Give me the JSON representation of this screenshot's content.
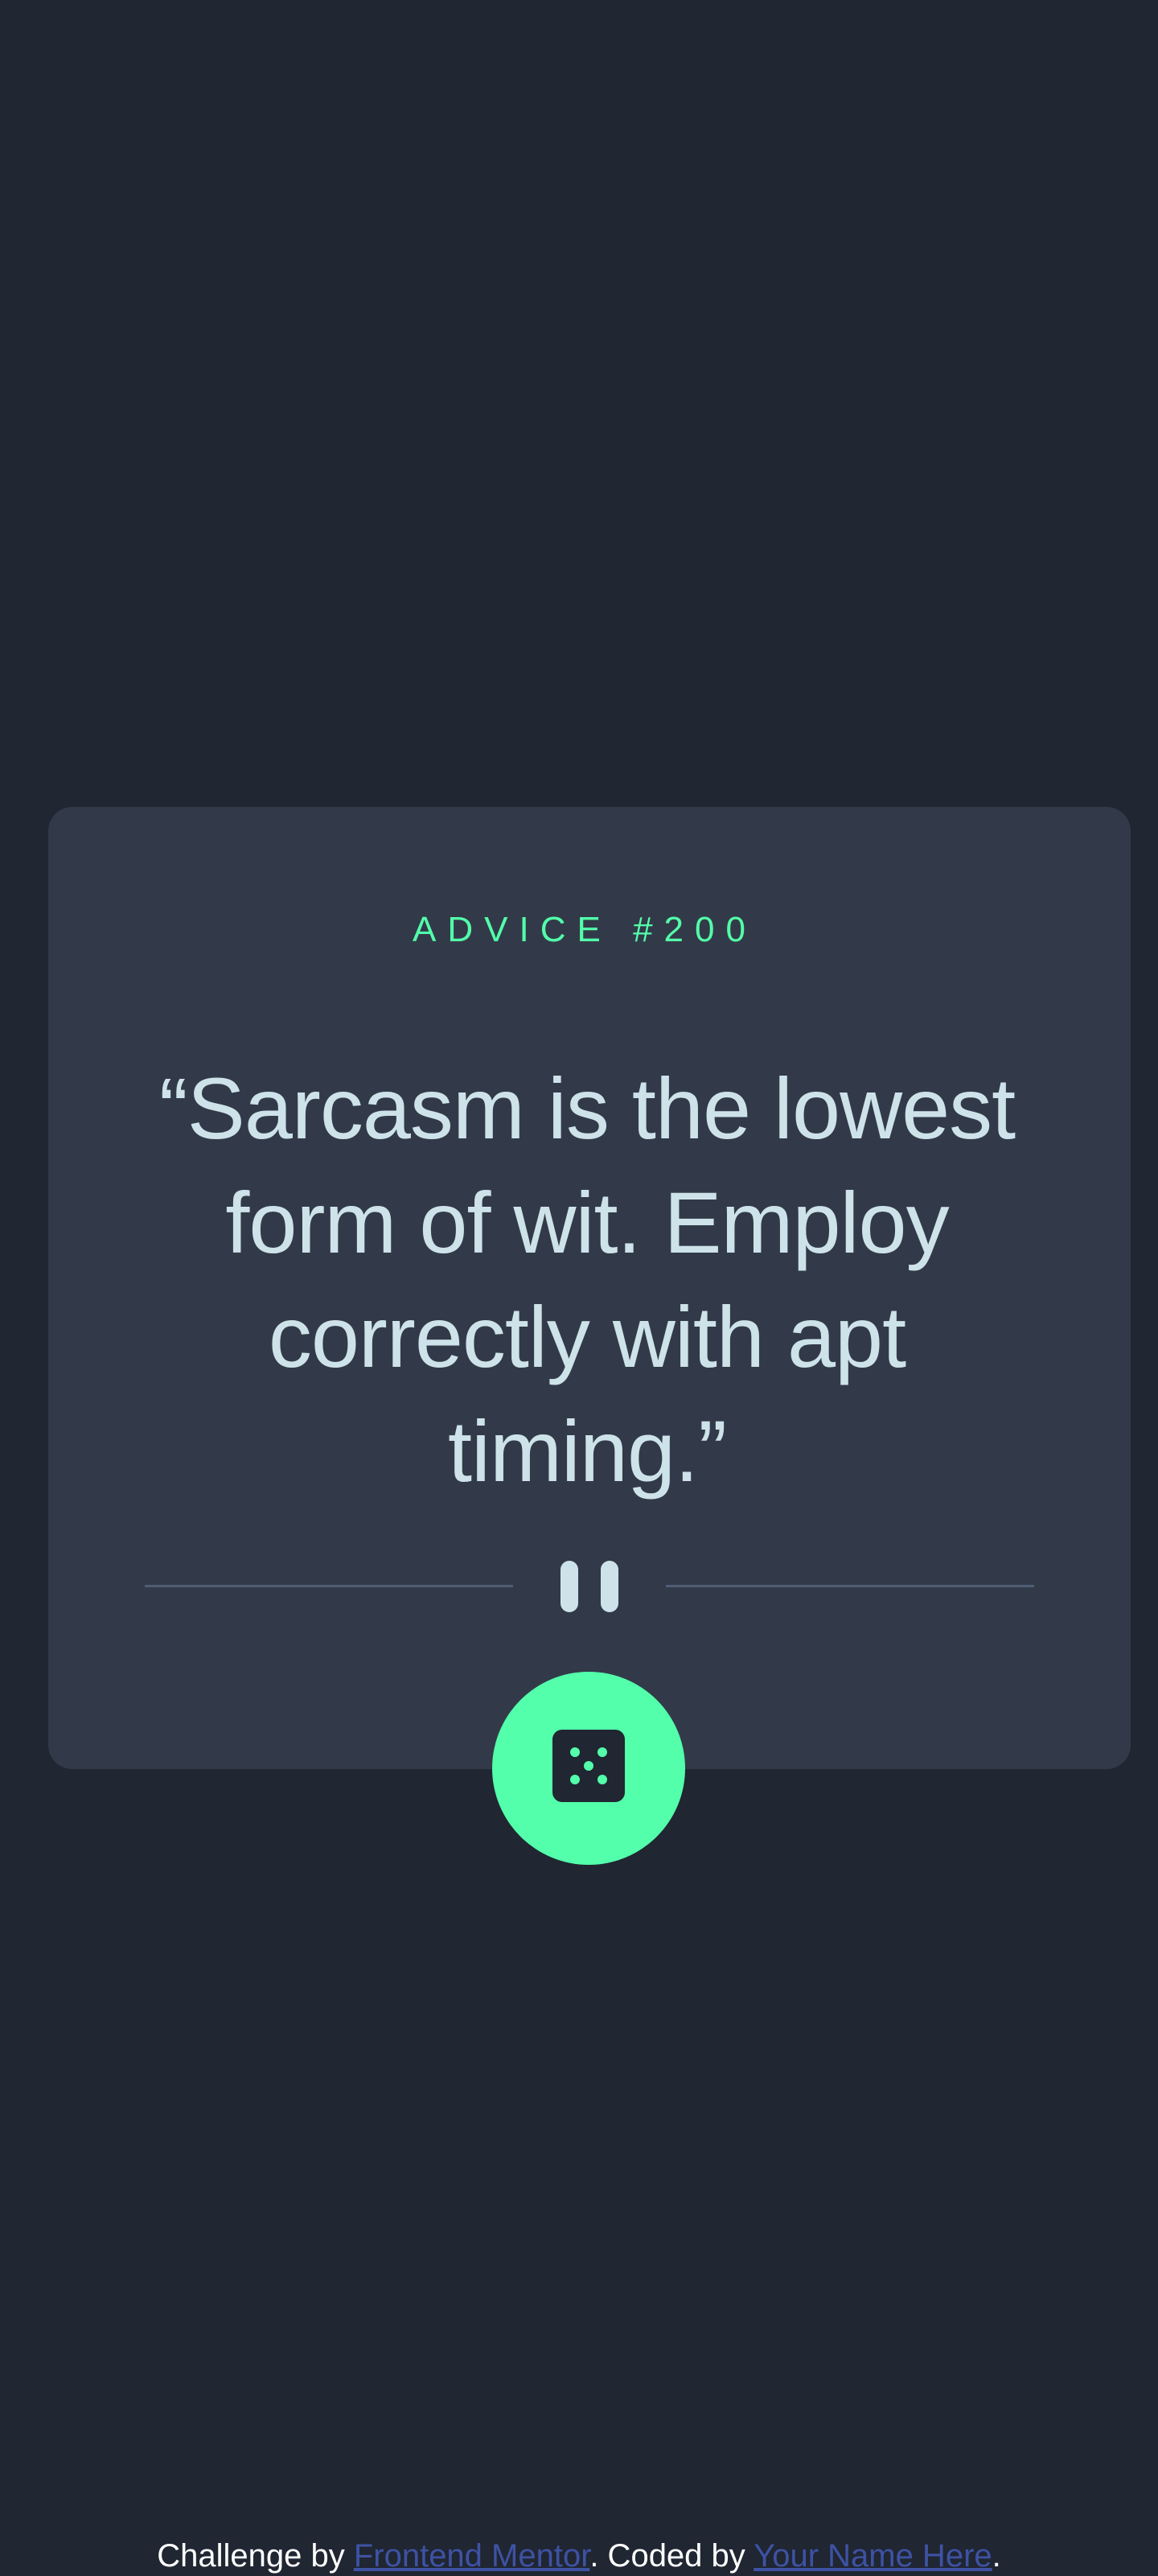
{
  "advice": {
    "id_label": "ADVICE #200",
    "quote": "“Sarcasm is the lowest form of wit. Employ correctly with apt timing.”"
  },
  "divider": {
    "icon": "pause-icon"
  },
  "dice_button": {
    "icon": "dice-icon"
  },
  "footer": {
    "prefix": "Challenge by ",
    "link1": "Frontend Mentor",
    "middle": ". Coded by ",
    "link2": "Your Name Here",
    "suffix": "."
  },
  "colors": {
    "background": "#202632",
    "card": "#323a49",
    "accent": "#53ffaa",
    "text": "#cee3e9",
    "divider": "#4f5d74",
    "link": "#3e52a3"
  }
}
